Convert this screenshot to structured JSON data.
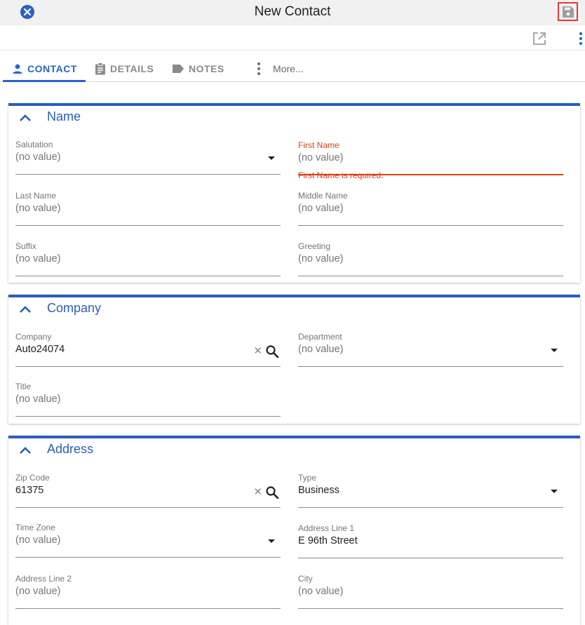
{
  "header": {
    "title": "New Contact"
  },
  "tabs": [
    {
      "label": "CONTACT",
      "icon": "person-icon"
    },
    {
      "label": "DETAILS",
      "icon": "clipboard-icon"
    },
    {
      "label": "NOTES",
      "icon": "label-icon"
    },
    {
      "label": "More...",
      "icon": "more-vert-icon"
    }
  ],
  "colors": {
    "accent": "#2c5db8",
    "error": "#d84315",
    "save_highlight": "#e53935"
  },
  "sections": {
    "name": {
      "title": "Name",
      "salutation": {
        "label": "Salutation",
        "value": "(no value)"
      },
      "first_name": {
        "label": "First Name",
        "value": "(no value)",
        "error": "First Name is required."
      },
      "last_name": {
        "label": "Last Name",
        "value": "(no value)"
      },
      "middle_name": {
        "label": "Middle Name",
        "value": "(no value)"
      },
      "suffix": {
        "label": "Suffix",
        "value": "(no value)"
      },
      "greeting": {
        "label": "Greeting",
        "value": "(no value)"
      }
    },
    "company": {
      "title": "Company",
      "company": {
        "label": "Company",
        "value": "Auto24074"
      },
      "department": {
        "label": "Department",
        "value": "(no value)"
      },
      "job_title": {
        "label": "Title",
        "value": "(no value)"
      }
    },
    "address": {
      "title": "Address",
      "zip": {
        "label": "Zip Code",
        "value": "61375"
      },
      "type": {
        "label": "Type",
        "value": "Business"
      },
      "time_zone": {
        "label": "Time Zone",
        "value": "(no value)"
      },
      "line1": {
        "label": "Address Line 1",
        "value": "E 96th Street"
      },
      "line2": {
        "label": "Address Line 2",
        "value": "(no value)"
      },
      "city": {
        "label": "City",
        "value": "(no value)"
      }
    }
  },
  "glyphs": {
    "clear": "✕"
  }
}
